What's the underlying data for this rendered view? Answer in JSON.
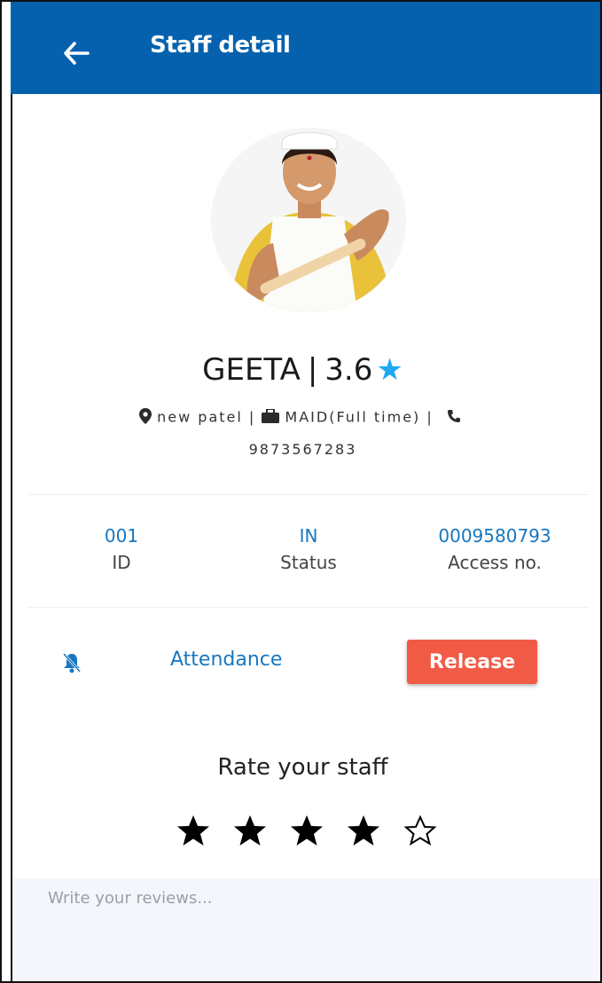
{
  "header": {
    "title": "Staff detail",
    "background_color": "#0561ae",
    "back_icon": "arrow-left-icon"
  },
  "profile": {
    "name": "GEETA",
    "separator": "|",
    "rating": "3.6",
    "rating_icon": "star-icon",
    "rating_color": "#1ea8f0",
    "location": "new patel",
    "job": "MAID(Full time)",
    "phone": "9873567283",
    "meta_separator": "|"
  },
  "stats": [
    {
      "value": "001",
      "label": "ID"
    },
    {
      "value": "IN",
      "label": "Status"
    },
    {
      "value": "0009580793",
      "label": "Access no."
    }
  ],
  "actions": {
    "bell_icon": "bell-off-icon",
    "attendance_label": "Attendance",
    "release_label": "Release",
    "release_color": "#f15b45"
  },
  "rating_section": {
    "title": "Rate your staff",
    "selected": 4,
    "max": 5
  },
  "review": {
    "placeholder": "Write your reviews..."
  }
}
